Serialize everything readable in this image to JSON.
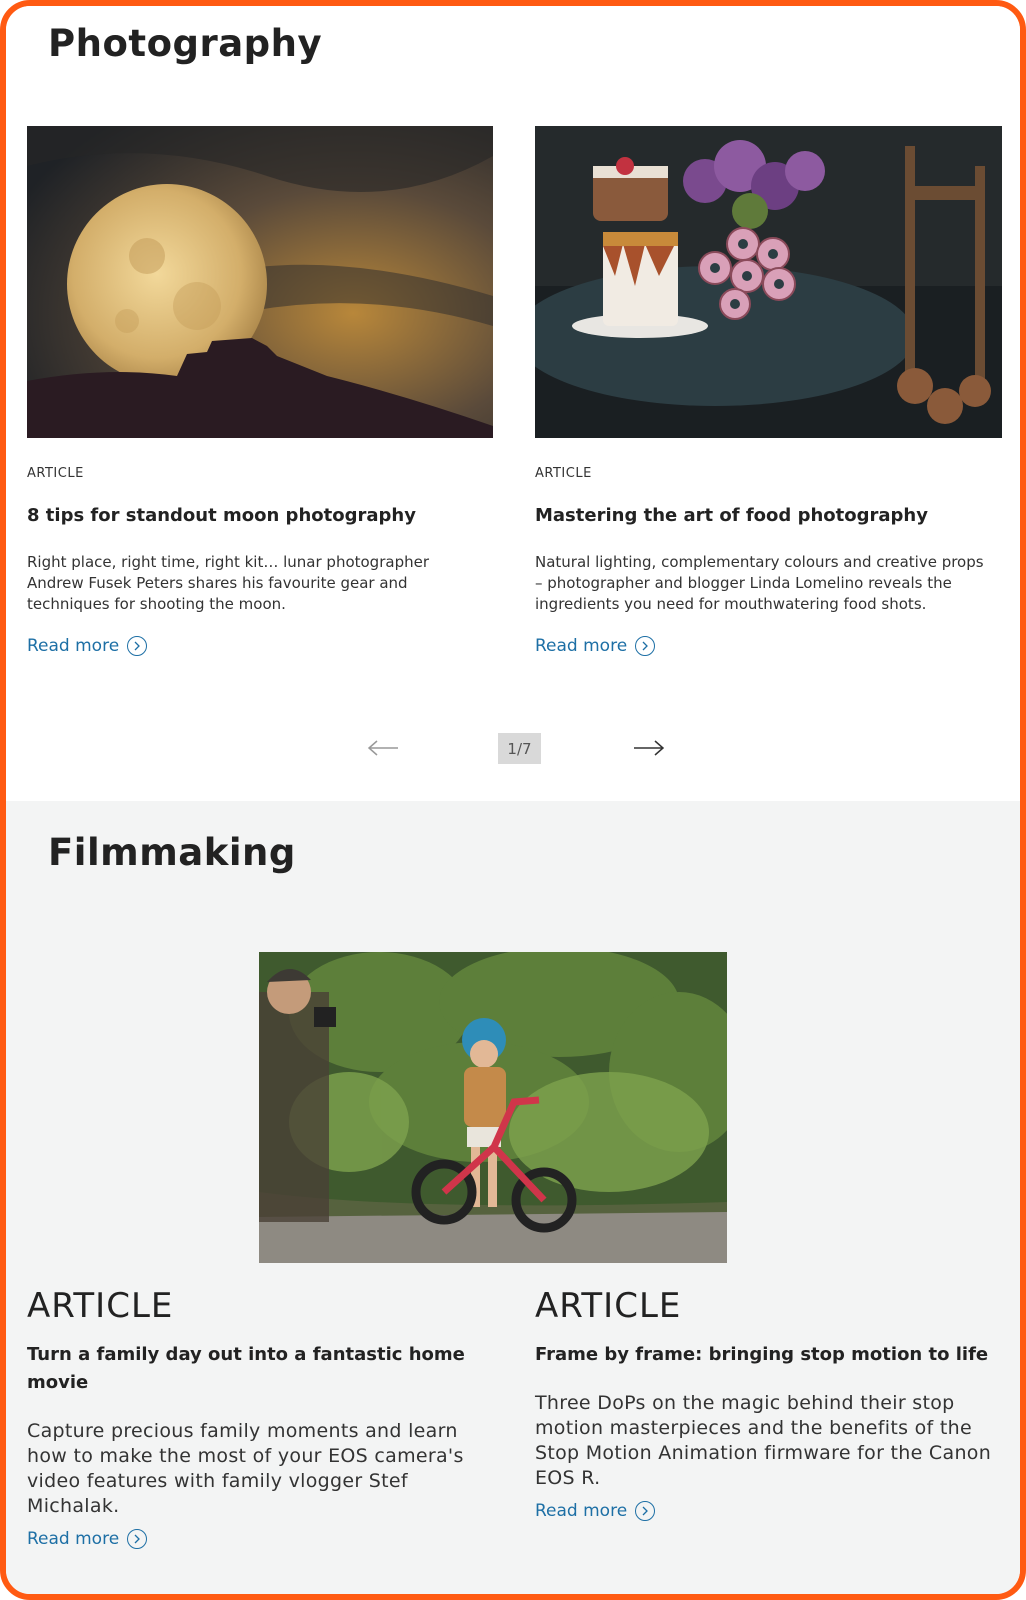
{
  "photography": {
    "title": "Photography",
    "cards": [
      {
        "kicker": "ARTICLE",
        "title": "8 tips for standout moon photography",
        "description": "Right place, right time, right kit… lunar photographer Andrew Fusek Peters shares his favourite gear and techniques for shooting the moon.",
        "read_more": "Read more",
        "image_icon": "moon-photo"
      },
      {
        "kicker": "ARTICLE",
        "title": "Mastering the art of food photography",
        "description": "Natural lighting, complementary colours and creative props – photographer and blogger Linda Lomelino reveals the ingredients you need for mouthwatering food shots.",
        "read_more": "Read more",
        "image_icon": "food-photo"
      }
    ],
    "pager": {
      "count": "1/7",
      "prev_icon": "arrow-left-icon",
      "next_icon": "arrow-right-icon"
    }
  },
  "filmmaking": {
    "title": "Filmmaking",
    "cards": [
      {
        "kicker": "ARTICLE",
        "title": "Turn a family day out into a fantastic home movie",
        "description": "Capture precious family moments and learn how to make the most of your EOS camera's video features with family vlogger Stef Michalak.",
        "read_more": "Read more",
        "image_icon": "family-bike-photo"
      },
      {
        "kicker": "ARTICLE",
        "title": "Frame by frame: bringing stop motion to life",
        "description": "Three DoPs on the magic behind their stop motion masterpieces and the benefits of the Stop Motion Animation firmware for the Canon EOS R.",
        "read_more": "Read more"
      }
    ]
  },
  "colors": {
    "frame_border": "#ff5a12",
    "link": "#1d6fa5",
    "section_bg_alt": "#f3f4f4"
  }
}
